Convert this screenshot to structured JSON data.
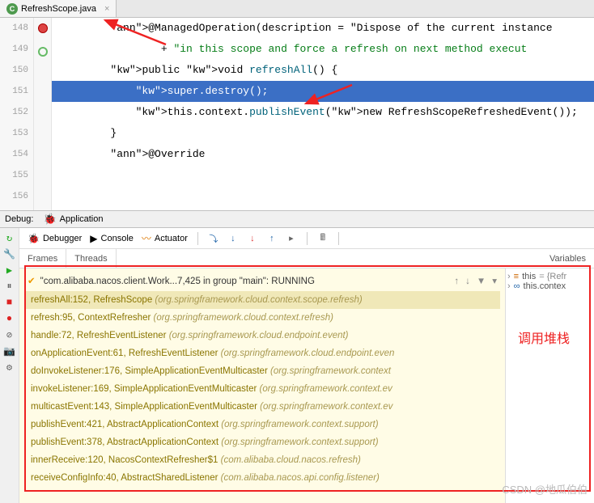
{
  "tab": {
    "filename": "RefreshScope.java"
  },
  "code": {
    "lines": [
      {
        "n": 148,
        "t": ""
      },
      {
        "n": 149,
        "t": "        @ManagedOperation(description = \"Dispose of the current instance "
      },
      {
        "n": 150,
        "t": "                + \"in this scope and force a refresh on next method execut"
      },
      {
        "n": 151,
        "t": "        public void refreshAll() {"
      },
      {
        "n": 152,
        "t": "            super.destroy();",
        "hl": true,
        "bp": true
      },
      {
        "n": 153,
        "t": "            this.context.publishEvent(new RefreshScopeRefreshedEvent());",
        "run": true
      },
      {
        "n": 154,
        "t": "        }"
      },
      {
        "n": 155,
        "t": ""
      },
      {
        "n": 156,
        "t": "        @Override"
      }
    ]
  },
  "debug": {
    "label": "Debug:",
    "app": "Application",
    "tabs": {
      "debugger": "Debugger",
      "console": "Console",
      "actuator": "Actuator"
    },
    "frames": "Frames",
    "threads": "Threads",
    "variables": "Variables",
    "thread": "\"com.alibaba.nacos.client.Work...7,425 in group \"main\": RUNNING",
    "stack": [
      {
        "m": "refreshAll:152, RefreshScope",
        "p": "(org.springframework.cloud.context.scope.refresh)",
        "sel": true
      },
      {
        "m": "refresh:95, ContextRefresher",
        "p": "(org.springframework.cloud.context.refresh)"
      },
      {
        "m": "handle:72, RefreshEventListener",
        "p": "(org.springframework.cloud.endpoint.event)"
      },
      {
        "m": "onApplicationEvent:61, RefreshEventListener",
        "p": "(org.springframework.cloud.endpoint.even"
      },
      {
        "m": "doInvokeListener:176, SimpleApplicationEventMulticaster",
        "p": "(org.springframework.context"
      },
      {
        "m": "invokeListener:169, SimpleApplicationEventMulticaster",
        "p": "(org.springframework.context.ev"
      },
      {
        "m": "multicastEvent:143, SimpleApplicationEventMulticaster",
        "p": "(org.springframework.context.ev"
      },
      {
        "m": "publishEvent:421, AbstractApplicationContext",
        "p": "(org.springframework.context.support)"
      },
      {
        "m": "publishEvent:378, AbstractApplicationContext",
        "p": "(org.springframework.context.support)"
      },
      {
        "m": "innerReceive:120, NacosContextRefresher$1",
        "p": "(com.alibaba.cloud.nacos.refresh)"
      },
      {
        "m": "receiveConfigInfo:40, AbstractSharedListener",
        "p": "(com.alibaba.nacos.api.config.listener)"
      }
    ],
    "vars": [
      {
        "k": "this",
        "v": "= {Refr"
      },
      {
        "k": "this.contex",
        "v": ""
      }
    ]
  },
  "annotation": {
    "stack_label": "调用堆栈"
  },
  "watermark": "CSDN @地瓜伯伯"
}
